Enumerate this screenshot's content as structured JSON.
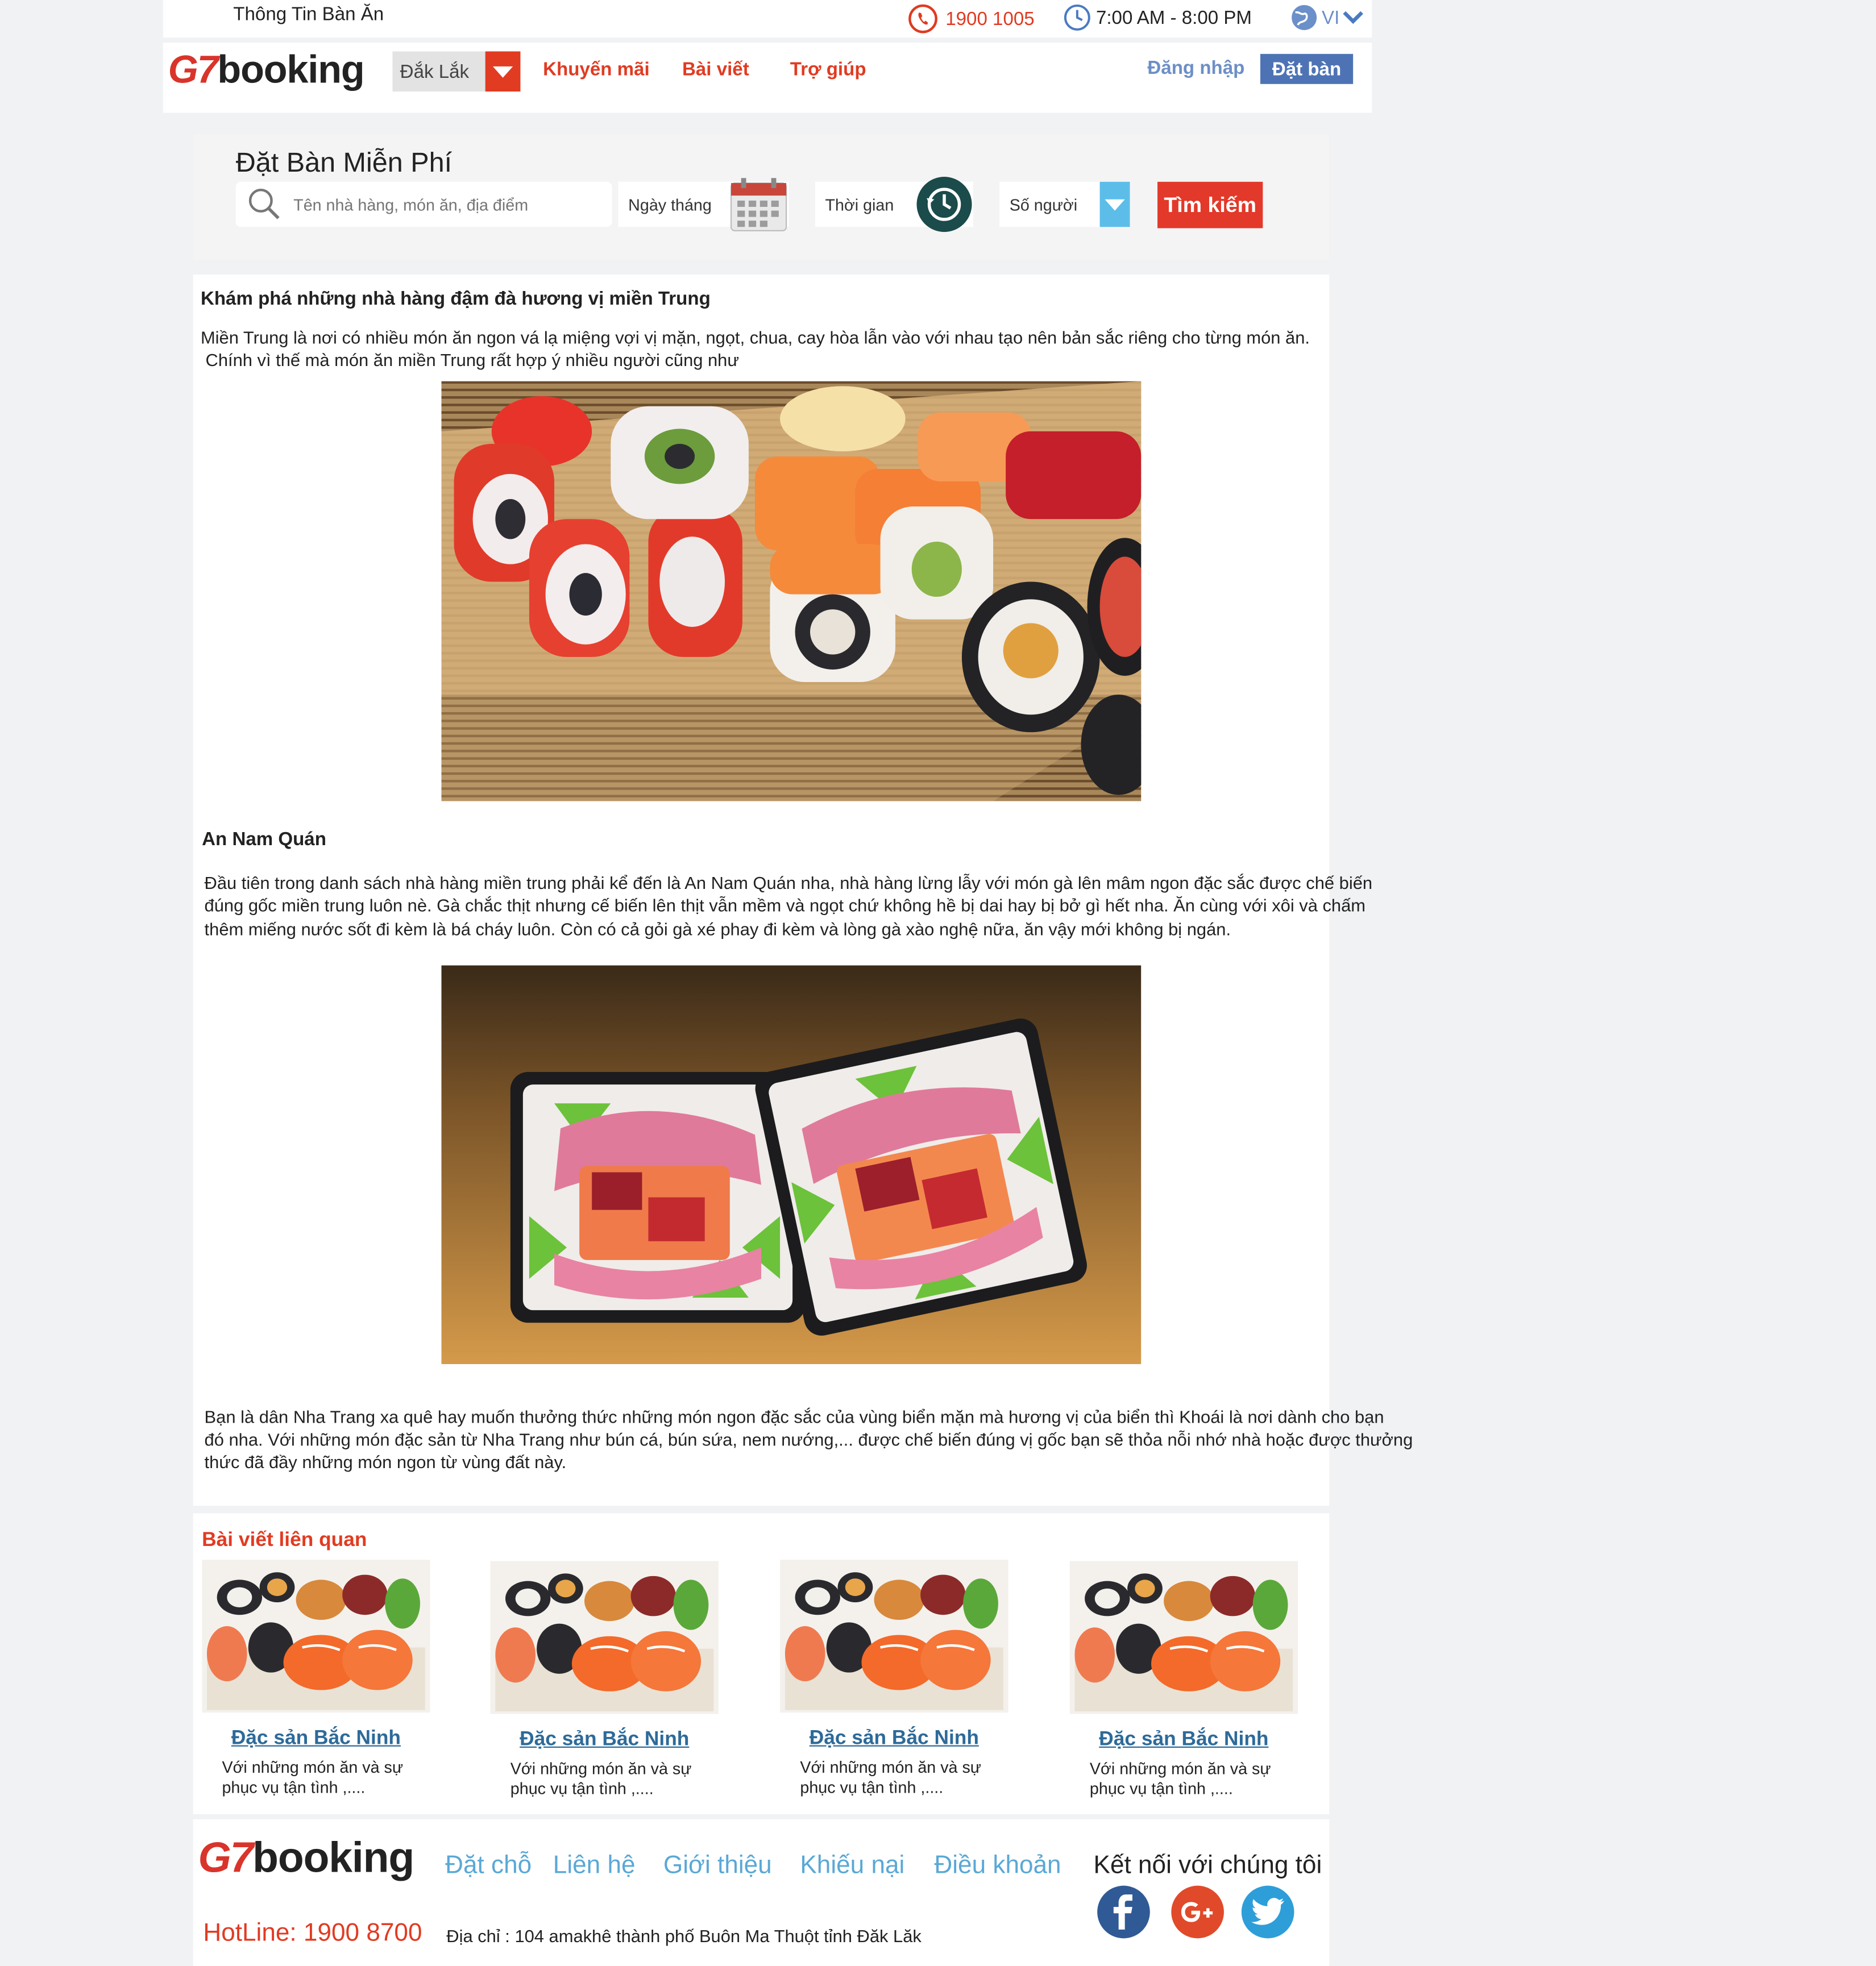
{
  "topbar": {
    "site_name": "Thông Tin Bàn Ăn",
    "phone": "1900 1005",
    "hours": "7:00 AM - 8:00 PM",
    "language": "VI"
  },
  "header": {
    "logo_g7": "G7",
    "logo_booking": "booking",
    "region": "Đắk Lắk",
    "nav": [
      "Khuyến mãi",
      "Bài viết",
      "Trợ giúp"
    ],
    "login": "Đăng nhập",
    "book": "Đặt bàn"
  },
  "search": {
    "title": "Đặt Bàn Miễn Phí",
    "placeholder": "Tên nhà hàng, món ăn, địa điểm",
    "date_label": "Ngày tháng",
    "time_label": "Thời gian",
    "people_label": "Số người",
    "button": "Tìm kiếm"
  },
  "article": {
    "heading": "Khám phá những nhà hàng đậm đà hương vị miền Trung",
    "intro_line1": "Miền Trung là nơi có nhiều món ăn ngon vá lạ miệng vợi vị mặn, ngọt, chua, cay hòa lẫn vào với nhau tạo nên bản sắc riêng cho từng món ăn.",
    "intro_line2": " Chính vì thế mà món ăn miền Trung rất hợp ý nhiều người cũng như",
    "section_title": "An Nam Quán",
    "para1_line1": "Đầu tiên trong danh sách nhà hàng miền trung phải kể đến là An Nam Quán nha, nhà hàng lừng lẫy với món gà lên mâm ngon đặc sắc được chế biến",
    "para1_line2": "đúng gốc miền trung luôn nè. Gà chắc thịt nhưng cế biến lên thịt vẫn mềm và ngọt chứ không hề bị dai hay bị bở gì hết nha. Ăn cùng với xôi và chấm",
    "para1_line3": "thêm miếng nước sốt đi kèm là bá cháy luôn. Còn có cả gỏi gà xé phay đi kèm và lòng gà xào nghệ nữa, ăn vậy mới không bị ngán.",
    "para2_line1": "Bạn là dân Nha Trang xa quê hay muốn thưởng thức những món ngon đặc sắc của vùng biển mặn mà hương vị của biển thì Khoái là nơi dành cho bạn",
    "para2_line2": "đó nha. Với những món đặc sản từ Nha Trang như bún cá, bún sứa, nem nướng,... được chế biến đúng vị gốc bạn sẽ thỏa nỗi nhớ nhà hoặc được thưởng",
    "para2_line3": "thức đã đầy những món ngon từ vùng đất này."
  },
  "related": {
    "title": "Bài viết liên quan",
    "cards": [
      {
        "title": "Đặc sản Bắc Ninh",
        "desc": "Với những món ăn và sự phục vụ tận tình ,...."
      },
      {
        "title": "Đặc sản Bắc Ninh",
        "desc": "Với những món ăn và sự phục vụ tận tình ,...."
      },
      {
        "title": "Đặc sản Bắc Ninh",
        "desc": "Với những món ăn và sự phục vụ tận tình ,...."
      },
      {
        "title": "Đặc sản Bắc Ninh",
        "desc": "Với những món ăn và sự phục vụ tận tình ,...."
      }
    ]
  },
  "footer": {
    "logo_g7": "G7",
    "logo_booking": "booking",
    "links": [
      "Đặt chỗ",
      "Liên hệ",
      "Giới thiệu",
      "Khiếu nại",
      "Điều khoản"
    ],
    "connect": "Kết nối với chúng tôi",
    "hotline": "HotLine: 1900 8700",
    "address": "Địa chỉ : 104 amakhê thành phố Buôn Ma Thuột tỉnh Đăk Lăk",
    "social_icons": [
      "facebook-icon",
      "google-plus-icon",
      "twitter-icon"
    ]
  },
  "colors": {
    "brand_red": "#e13b22",
    "link_blue": "#5aa8d6",
    "button_blue": "#4e73b5"
  }
}
